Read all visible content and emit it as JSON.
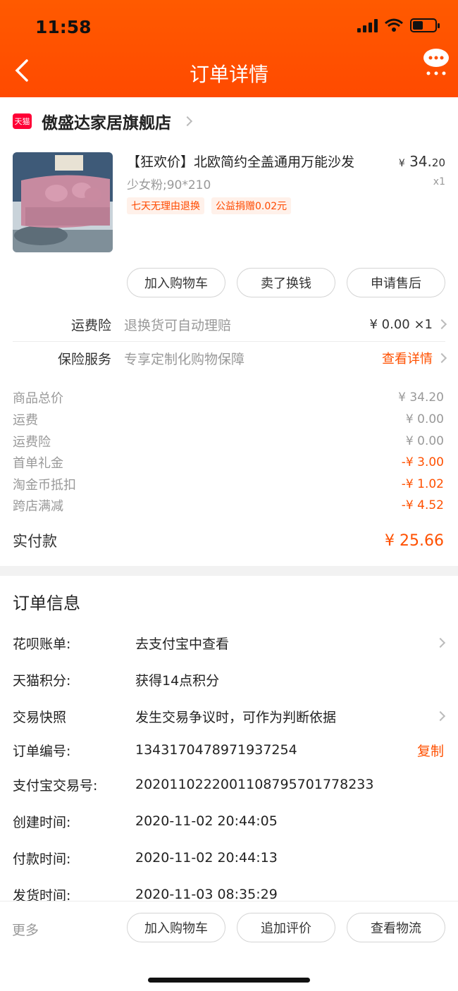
{
  "status_bar": {
    "time": "11:58"
  },
  "header": {
    "title": "订单详情"
  },
  "shop": {
    "badge": "天猫",
    "name": "傲盛达家居旗舰店"
  },
  "product": {
    "title": "【狂欢价】北欧简约全盖通用万能沙发",
    "sku": "少女粉;90*210",
    "tags": [
      "七天无理由退换",
      "公益捐赠0.02元"
    ],
    "price_currency": "¥",
    "price_int": "34.",
    "price_dec": "20",
    "qty": "x1",
    "buttons": [
      "加入购物车",
      "卖了换钱",
      "申请售后"
    ]
  },
  "services": [
    {
      "label": "运费险",
      "desc": "退换货可自动理赔",
      "value": "¥ 0.00 ×1"
    },
    {
      "label": "保险服务",
      "desc": "专享定制化购物保障",
      "value": "查看详情"
    }
  ],
  "costs": [
    {
      "label": "商品总价",
      "value": "¥ 34.20"
    },
    {
      "label": "运费",
      "value": "¥ 0.00"
    },
    {
      "label": "运费险",
      "value": "¥ 0.00"
    },
    {
      "label": "首单礼金",
      "value": "-¥ 3.00"
    },
    {
      "label": "淘金币抵扣",
      "value": "-¥ 1.02"
    },
    {
      "label": "跨店满减",
      "value": "-¥ 4.52"
    }
  ],
  "total": {
    "label": "实付款",
    "value": "¥ 25.66"
  },
  "order_info": {
    "title": "订单信息",
    "rows": [
      {
        "label": "花呗账单:",
        "value": "去支付宝中查看"
      },
      {
        "label": "天猫积分:",
        "value": "获得14点积分"
      },
      {
        "label": "交易快照",
        "value": "发生交易争议时，可作为判断依据"
      },
      {
        "label": "订单编号:",
        "value": "1343170478971937254",
        "action": "复制"
      },
      {
        "label": "支付宝交易号:",
        "value": "2020110222001108795701778233"
      },
      {
        "label": "创建时间:",
        "value": "2020-11-02 20:44:05"
      },
      {
        "label": "付款时间:",
        "value": "2020-11-02 20:44:13"
      },
      {
        "label": "发货时间:",
        "value": "2020-11-03 08:35:29"
      }
    ]
  },
  "bottom_bar": {
    "more": "更多",
    "buttons": [
      "加入购物车",
      "追加评价",
      "查看物流"
    ]
  },
  "colors": {
    "header": "#ff5000",
    "accent": "#ff5000",
    "tmall": "#ff0036"
  }
}
